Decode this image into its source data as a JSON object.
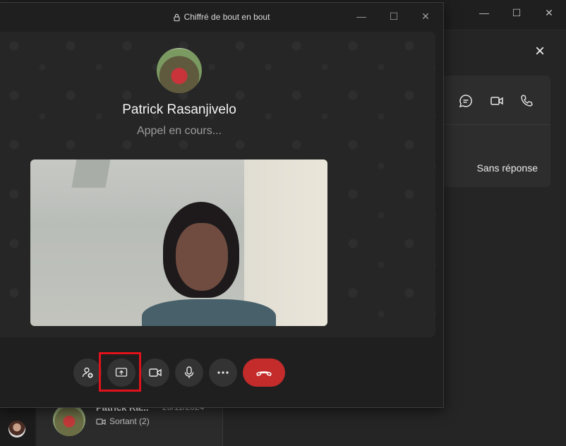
{
  "call_window": {
    "title": "Chiffré de bout en bout",
    "callee_name": "Patrick Rasanjivelo",
    "status": "Appel en cours..."
  },
  "controls": {
    "add_participant_icon": "add-person-icon",
    "share_screen_icon": "share-screen-icon",
    "camera_icon": "video-camera-icon",
    "mic_icon": "microphone-icon",
    "more_icon": "more-dots-icon",
    "hangup_icon": "end-call-icon",
    "hangup_color": "#c42b2b",
    "highlight_color": "#e0121b"
  },
  "contact_panel": {
    "status": "Sans réponse"
  },
  "chat_list": {
    "items": [
      {
        "name": "Patrick Ra...",
        "date": "26/11/2024",
        "subtitle": "Sortant (2)"
      }
    ]
  }
}
